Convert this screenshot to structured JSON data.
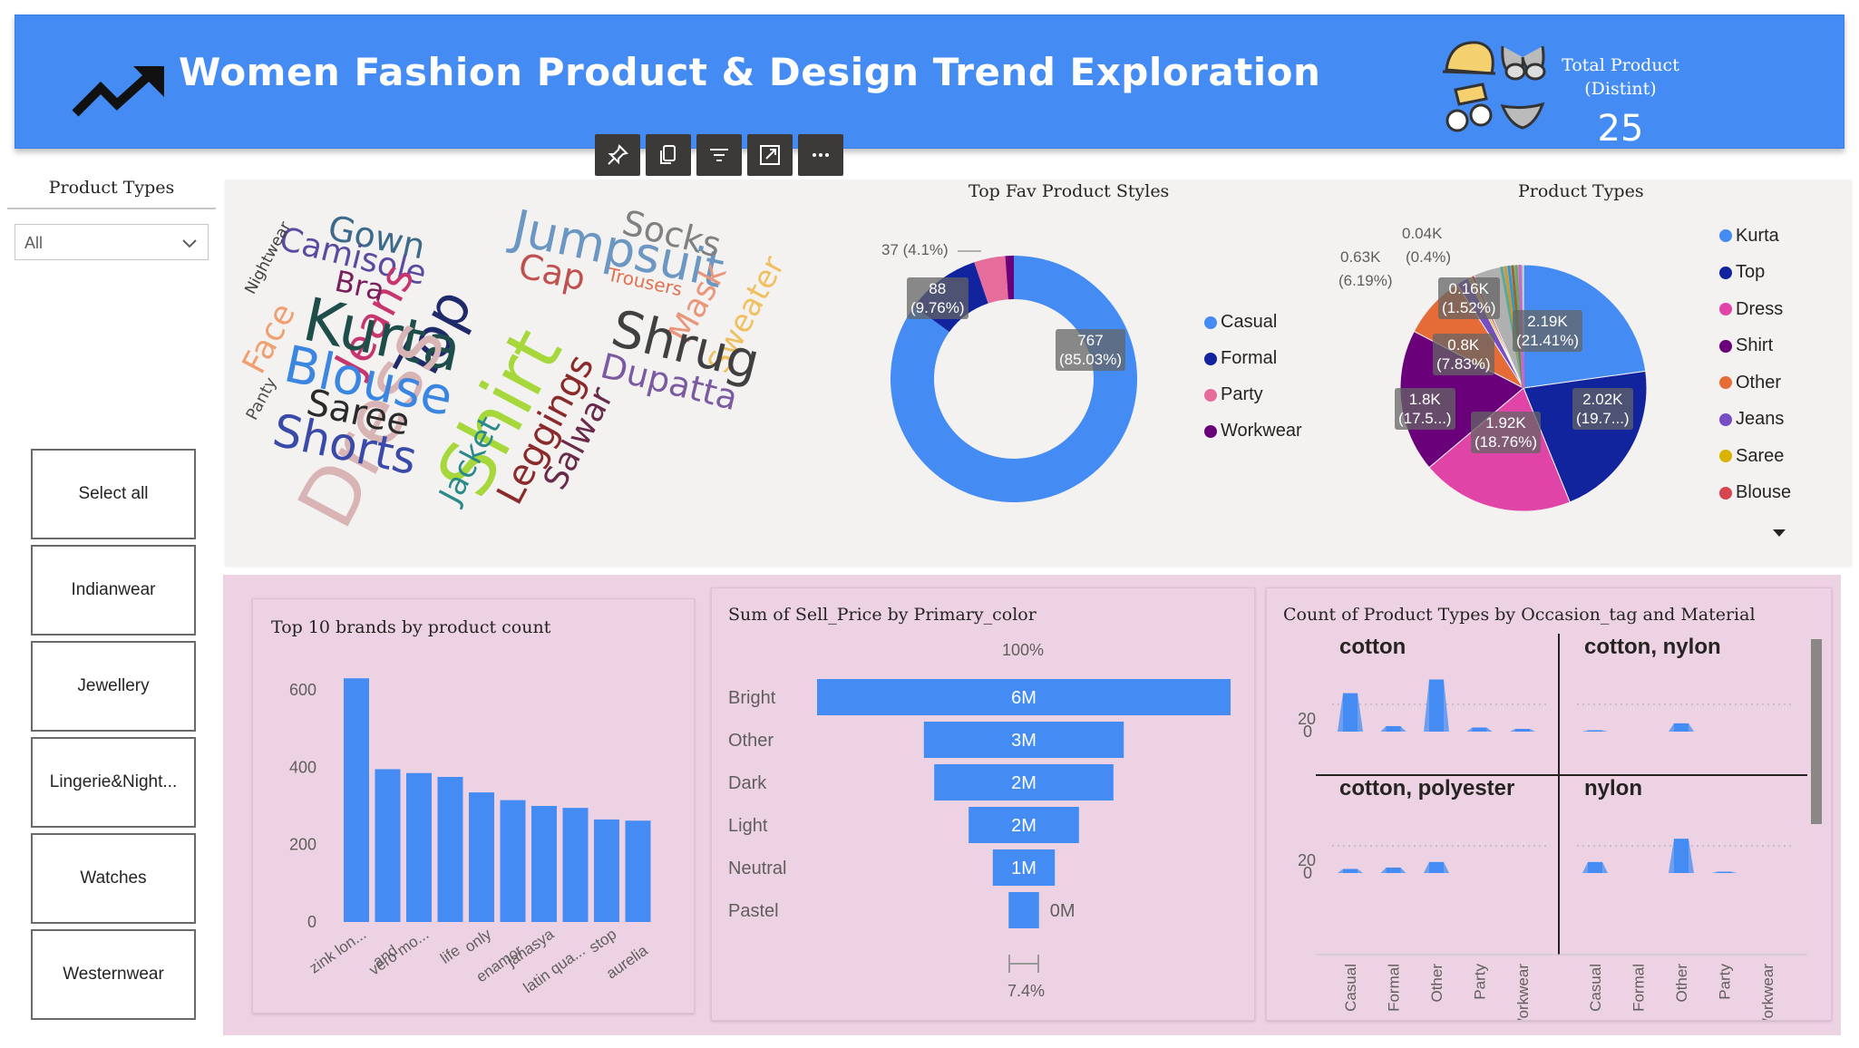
{
  "header": {
    "title": "Women Fashion Product & Design Trend Exploration",
    "kpi_label_line1": "Total Product",
    "kpi_label_line2": "(Distint)",
    "kpi_value": "25",
    "bg_color": "#448cf3"
  },
  "toolbar": {
    "icons": [
      "pin-icon",
      "copy-icon",
      "filter-icon",
      "focus-mode-icon",
      "more-options-icon"
    ]
  },
  "slicer": {
    "title": "Product Types",
    "dropdown_value": "All",
    "buttons": [
      "Select all",
      "Indianwear",
      "Jewellery",
      "Lingerie&Night...",
      "Watches",
      "Westernwear"
    ]
  },
  "word_cloud": {
    "words": [
      {
        "text": "Gown",
        "color": "#3e6a8a"
      },
      {
        "text": "Camisole",
        "color": "#5a4aa0"
      },
      {
        "text": "Jeans",
        "color": "#c7356e"
      },
      {
        "text": "Top",
        "color": "#1f2a6b"
      },
      {
        "text": "Jumpsuit",
        "color": "#6c97c2"
      },
      {
        "text": "Socks",
        "color": "#808080"
      },
      {
        "text": "Nightwear",
        "color": "#404040"
      },
      {
        "text": "Bra",
        "color": "#7a1f5e"
      },
      {
        "text": "Cap",
        "color": "#c0504d"
      },
      {
        "text": "Trousers",
        "color": "#e07050"
      },
      {
        "text": "Mask",
        "color": "#e9967a"
      },
      {
        "text": "Sweater",
        "color": "#f0c060"
      },
      {
        "text": "Face",
        "color": "#f0a070"
      },
      {
        "text": "Kurta",
        "color": "#1f4e4a"
      },
      {
        "text": "Dress",
        "color": "#d8b4b4"
      },
      {
        "text": "Shrug",
        "color": "#404040"
      },
      {
        "text": "Blouse",
        "color": "#3a86e0"
      },
      {
        "text": "Shirt",
        "color": "#a6d83c"
      },
      {
        "text": "Dupatta",
        "color": "#7a5aa0"
      },
      {
        "text": "Panty",
        "color": "#505050"
      },
      {
        "text": "Saree",
        "color": "#2a2a2a"
      },
      {
        "text": "Shorts",
        "color": "#3a4aa8"
      },
      {
        "text": "Jacket",
        "color": "#2a8a8a"
      },
      {
        "text": "Leggings",
        "color": "#8a2a2a"
      },
      {
        "text": "Salwar",
        "color": "#6a2a4a"
      }
    ]
  },
  "styles_chart": {
    "title": "Top Fav Product Styles",
    "label_outer": "37 (4.1%)",
    "label_88_a": "88",
    "label_88_b": "(9.76%)",
    "label_767_a": "767",
    "label_767_b": "(85.03%)",
    "legend": [
      "Casual",
      "Formal",
      "Party",
      "Workwear"
    ],
    "colors": [
      "#448cf3",
      "#12239e",
      "#e66c9c",
      "#6b007b"
    ]
  },
  "types_chart": {
    "title": "Product Types",
    "labels": {
      "a1": "0.04K",
      "a2": "0.63K",
      "a3": "(0.4%)",
      "a4": "(6.19%)",
      "b1": "0.16K",
      "b2": "(1.52%)",
      "c1": "2.19K",
      "c2": "(21.41%)",
      "d1": "0.8K",
      "d2": "(7.83%)",
      "e1": "2.02K",
      "e2": "(19.7...)",
      "f1": "1.8K",
      "f2": "(17.5...)",
      "g1": "1.92K",
      "g2": "(18.76%)"
    },
    "legend": [
      "Kurta",
      "Top",
      "Dress",
      "Shirt",
      "Other",
      "Jeans",
      "Saree",
      "Blouse"
    ],
    "legend_colors": [
      "#448cf3",
      "#12239e",
      "#e044a7",
      "#6b007b",
      "#e66c37",
      "#744ec2",
      "#d9b300",
      "#d64550"
    ]
  },
  "brands_chart": {
    "title": "Top 10 brands by product count",
    "yticks": [
      "600",
      "400",
      "200",
      "0"
    ],
    "color": "#448cf3"
  },
  "funnel_chart": {
    "title": "Sum of Sell_Price by Primary_color",
    "top_pct": "100%",
    "bottom_pct": "7.4%",
    "color": "#448cf3"
  },
  "small_multiples": {
    "title": "Count of Product Types by Occasion_tag and Material",
    "panels": [
      "cotton",
      "cotton, nylon",
      "cotton, polyester",
      "nylon"
    ],
    "yticks": [
      "20",
      "0"
    ],
    "xticks": [
      "Casual",
      "Formal",
      "Other",
      "Party",
      "Workwear"
    ]
  },
  "chart_data": [
    {
      "type": "pie",
      "title": "Top Fav Product Styles",
      "categories": [
        "Casual",
        "Formal",
        "Party",
        "Workwear"
      ],
      "values": [
        767,
        88,
        37,
        10
      ]
    },
    {
      "type": "pie",
      "title": "Product Types",
      "categories": [
        "Kurta",
        "Top",
        "Dress",
        "Shirt",
        "Other",
        "Jeans",
        "Saree",
        "Blouse",
        "Other small"
      ],
      "values": [
        2190,
        2020,
        1920,
        1800,
        800,
        160,
        40,
        40,
        630
      ]
    },
    {
      "type": "bar",
      "title": "Top 10 brands by product count",
      "categories": [
        "zink lon...",
        "and",
        "vero mo...",
        "life",
        "only",
        "enamor",
        "janasya",
        "latin qua...",
        "stop",
        "aurelia"
      ],
      "values": [
        630,
        395,
        385,
        375,
        335,
        315,
        300,
        295,
        265,
        262
      ],
      "ylim": [
        0,
        650
      ]
    },
    {
      "type": "bar",
      "title": "Sum of Sell_Price by Primary_color",
      "categories": [
        "Bright",
        "Other",
        "Dark",
        "Light",
        "Neutral",
        "Pastel"
      ],
      "value_labels": [
        "6M",
        "3M",
        "2M",
        "2M",
        "1M",
        "0M"
      ],
      "values": [
        6.0,
        2.9,
        2.6,
        1.6,
        0.9,
        0.44
      ]
    },
    {
      "type": "area",
      "title": "Count of Product Types by Occasion_tag and Material",
      "categories": [
        "Casual",
        "Formal",
        "Other",
        "Party",
        "Workwear"
      ],
      "series": [
        {
          "name": "cotton",
          "values": [
            28,
            4,
            38,
            3,
            2
          ]
        },
        {
          "name": "cotton, nylon",
          "values": [
            1,
            0,
            6,
            0,
            0
          ]
        },
        {
          "name": "cotton, polyester",
          "values": [
            3,
            4,
            8,
            0,
            0
          ]
        },
        {
          "name": "nylon",
          "values": [
            8,
            0,
            25,
            1,
            0
          ]
        }
      ],
      "ylim": [
        0,
        45
      ]
    }
  ]
}
